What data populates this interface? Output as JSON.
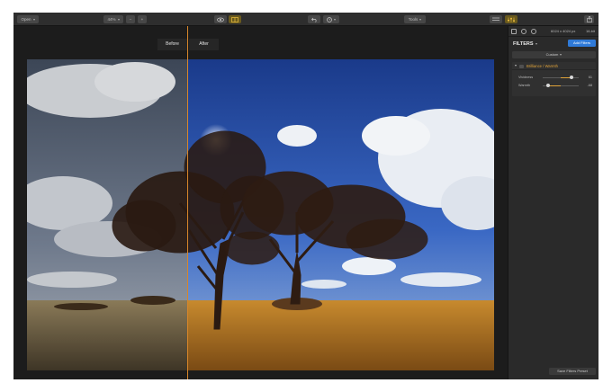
{
  "toolbar": {
    "view_dropdown": "Open",
    "zoom_value": "44%",
    "zoom_out": "−",
    "zoom_in": "+",
    "tools_dropdown": "Tools"
  },
  "viewer": {
    "before_label": "Before",
    "after_label": "After"
  },
  "panel": {
    "image_size": "6024 x 4024 px",
    "bit_depth": "16-bit",
    "filters_title": "FILTERS",
    "add_filters": "Add Filters",
    "preset": "Custom",
    "filter": {
      "name": "Brilliance / Warmth",
      "sliders": [
        {
          "label": "Vividness",
          "value": "61",
          "fraction": 0.8
        },
        {
          "label": "Warmth",
          "value": "-68",
          "fraction": 0.16
        }
      ]
    },
    "save_preset": "Save Filters Preset"
  },
  "colors": {
    "accent": "#2f7ad8",
    "split_line": "#d7862a",
    "filter_title": "#e0a33a"
  }
}
